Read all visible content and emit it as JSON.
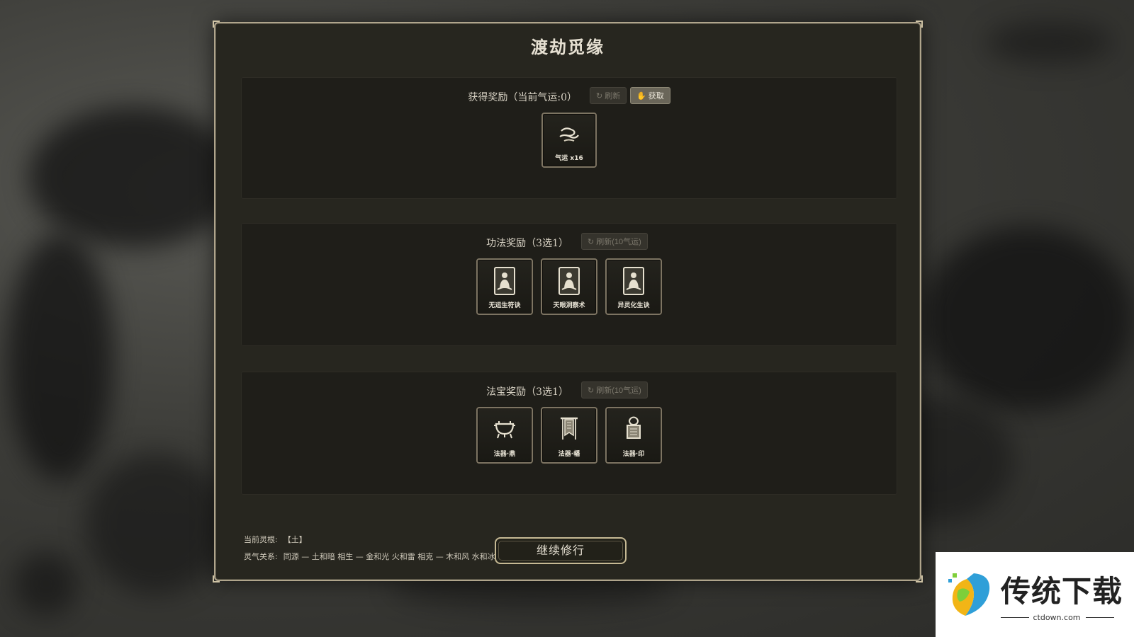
{
  "title": "渡劫觅缘",
  "reward_section": {
    "label": "获得奖励（当前气运:0）",
    "refresh_label": "刷新",
    "obtain_label": "获取",
    "items": [
      {
        "label": "气运 x16",
        "icon": "qiyun-cloud-icon"
      }
    ]
  },
  "gongfa_section": {
    "label": "功法奖励（3选1）",
    "refresh_label": "刷新(10气运)",
    "items": [
      {
        "label": "无运生符诀",
        "icon": "meditating-figure-icon"
      },
      {
        "label": "天眼洞察术",
        "icon": "meditating-figure-icon"
      },
      {
        "label": "异灵化生诀",
        "icon": "meditating-figure-icon"
      }
    ]
  },
  "fabao_section": {
    "label": "法宝奖励（3选1）",
    "refresh_label": "刷新(10气运)",
    "items": [
      {
        "label": "法器·鼎",
        "icon": "cauldron-icon"
      },
      {
        "label": "法器·幡",
        "icon": "banner-icon"
      },
      {
        "label": "法器·印",
        "icon": "seal-icon"
      }
    ]
  },
  "footer": {
    "root_label": "当前灵根:",
    "root_value": "【土】",
    "relation_label": "灵气关系:",
    "relation_value": "同源 — 土和暗  相生 — 金和光 火和雷  相克 — 木和风 水和冰"
  },
  "continue_label": "继续修行",
  "watermark": {
    "text": "传统下载",
    "url": "ctdown.com"
  },
  "colors": {
    "panel_bg": "#27261f",
    "border": "#b0a58c",
    "section_bg": "#1f1e19",
    "text": "#d8d2c4"
  }
}
